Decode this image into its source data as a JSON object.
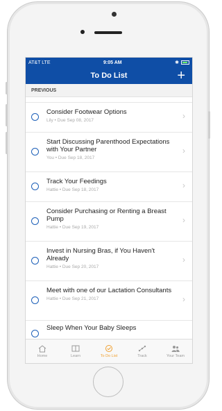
{
  "status": {
    "carrier": "AT&T LTE",
    "time": "9:05 AM"
  },
  "nav": {
    "title": "To Do List",
    "add_label": "+"
  },
  "section": {
    "label": "PREVIOUS"
  },
  "tasks": [
    {
      "title": "Consider Footwear Options",
      "meta": "Lily  •  Due Sep 08, 2017"
    },
    {
      "title": "Start Discussing Parenthood Expectations with Your Partner",
      "meta": "You  •  Due Sep 18, 2017"
    },
    {
      "title": "Track Your Feedings",
      "meta": "Hattie  •  Due Sep 18, 2017"
    },
    {
      "title": "Consider Purchasing or Renting a Breast Pump",
      "meta": "Hattie  •  Due Sep 19, 2017"
    },
    {
      "title": "Invest in Nursing Bras, if You Haven't Already",
      "meta": "Hattie  •  Due Sep 20, 2017"
    },
    {
      "title": "Meet with one of our Lactation Consultants",
      "meta": "Hattie  •  Due Sep 21, 2017"
    },
    {
      "title": "Sleep When Your Baby Sleeps",
      "meta": ""
    }
  ],
  "chevron": "›",
  "tabs": [
    {
      "label": "Home",
      "icon": "home-icon"
    },
    {
      "label": "Learn",
      "icon": "book-icon"
    },
    {
      "label": "To Do List",
      "icon": "check-icon",
      "active": true
    },
    {
      "label": "Track",
      "icon": "track-icon"
    },
    {
      "label": "Your Team",
      "icon": "team-icon"
    }
  ],
  "colors": {
    "nav_blue": "#0f4ea6",
    "active_tab": "#f0a030",
    "circle_blue": "#1c5fb8"
  }
}
